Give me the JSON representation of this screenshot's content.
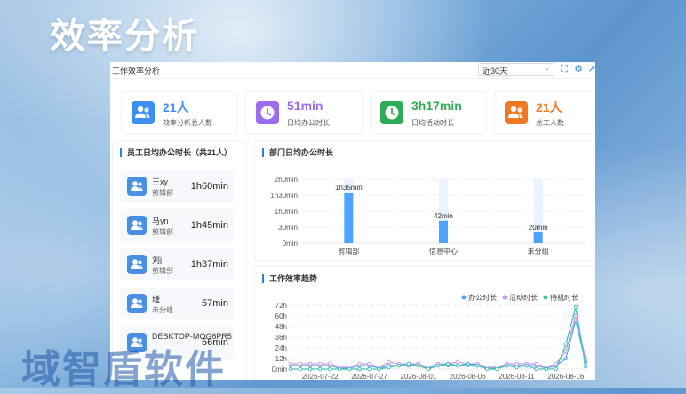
{
  "page_title": "效率分析",
  "watermark": "域智盾软件",
  "header": {
    "title": "工作效率分析",
    "range": "近30天"
  },
  "kpis": [
    {
      "value": "21人",
      "label": "效率分析总人数",
      "color": "#3d8ff2",
      "icon": "users-icon"
    },
    {
      "value": "51min",
      "label": "日均办公时长",
      "color": "#9b6cf0",
      "icon": "clock-icon"
    },
    {
      "value": "3h17min",
      "label": "日均活动时长",
      "color": "#2eac55",
      "icon": "clock-icon"
    },
    {
      "value": "21人",
      "label": "总工人数",
      "color": "#f07a24",
      "icon": "users-icon"
    }
  ],
  "employees": {
    "title": "员工日均办公时长（共21人）",
    "items": [
      {
        "name": "王xy",
        "dept": "剪辑部",
        "duration": "1h60min"
      },
      {
        "name": "马yn",
        "dept": "剪辑部",
        "duration": "1h45min"
      },
      {
        "name": "刘j",
        "dept": "剪辑部",
        "duration": "1h37min"
      },
      {
        "name": "瑾",
        "dept": "未分组",
        "duration": "57min"
      },
      {
        "name": "DESKTOP-MOG6PR5",
        "dept": "",
        "duration": "56min"
      }
    ]
  },
  "chart_data": [
    {
      "type": "bar",
      "title": "部门日均办公时长",
      "categories": [
        "剪辑部",
        "信息中心",
        "未分组"
      ],
      "values": [
        95,
        42,
        20
      ],
      "labels": [
        "1h35min",
        "42min",
        "20min"
      ],
      "ylim": [
        0,
        120
      ],
      "yticks": [
        0,
        30,
        60,
        90,
        120
      ],
      "ytick_labels": [
        "0min",
        "30min",
        "1h0min",
        "1h30min",
        "2h0min"
      ],
      "bar_color": "#4da3ff",
      "track_color": "#eaf3ff"
    },
    {
      "type": "line",
      "title": "工作效率趋势",
      "x": [
        "2026-07-19",
        "2026-07-20",
        "2026-07-21",
        "2026-07-22",
        "2026-07-23",
        "2026-07-24",
        "2026-07-25",
        "2026-07-26",
        "2026-07-27",
        "2026-07-28",
        "2026-07-29",
        "2026-07-30",
        "2026-07-31",
        "2026-08-01",
        "2026-08-02",
        "2026-08-03",
        "2026-08-04",
        "2026-08-05",
        "2026-08-06",
        "2026-08-07",
        "2026-08-08",
        "2026-08-09",
        "2026-08-10",
        "2026-08-11",
        "2026-08-12",
        "2026-08-13",
        "2026-08-14",
        "2026-08-15",
        "2026-08-16",
        "2026-08-17",
        "2026-08-18"
      ],
      "xtick_labels": [
        "2026-07-22",
        "2026-07-27",
        "2026-08-01",
        "2026-08-06",
        "2026-08-11",
        "2026-08-16"
      ],
      "xtick_index": [
        3,
        8,
        13,
        18,
        23,
        28
      ],
      "ylim": [
        0,
        72
      ],
      "yticks": [
        0,
        12,
        24,
        36,
        48,
        60,
        72
      ],
      "ytick_labels": [
        "0min",
        "12h",
        "24h",
        "36h",
        "48h",
        "60h",
        "72h"
      ],
      "legend_position": "top-right",
      "series": [
        {
          "name": "办公时长",
          "color": "#5aa6e6",
          "values": [
            4,
            4,
            4,
            4,
            4,
            1,
            1,
            4,
            4,
            1,
            4,
            4,
            4,
            4,
            1,
            4,
            4,
            4,
            4,
            4,
            1,
            1,
            4,
            4,
            4,
            4,
            1,
            4,
            12,
            55,
            8
          ]
        },
        {
          "name": "活动时长",
          "color": "#c89be6",
          "values": [
            6,
            6,
            6,
            6,
            6,
            2,
            2,
            6,
            6,
            2,
            8,
            6,
            6,
            6,
            2,
            6,
            6,
            8,
            6,
            6,
            2,
            2,
            6,
            6,
            6,
            6,
            2,
            6,
            20,
            60,
            12
          ]
        },
        {
          "name": "待机时长",
          "color": "#42c2b5",
          "values": [
            0,
            0,
            0,
            0,
            0,
            0,
            0,
            0,
            0,
            0,
            2,
            4,
            6,
            4,
            0,
            4,
            6,
            4,
            6,
            4,
            0,
            0,
            4,
            2,
            4,
            0,
            0,
            0,
            28,
            70,
            3
          ]
        }
      ]
    }
  ]
}
